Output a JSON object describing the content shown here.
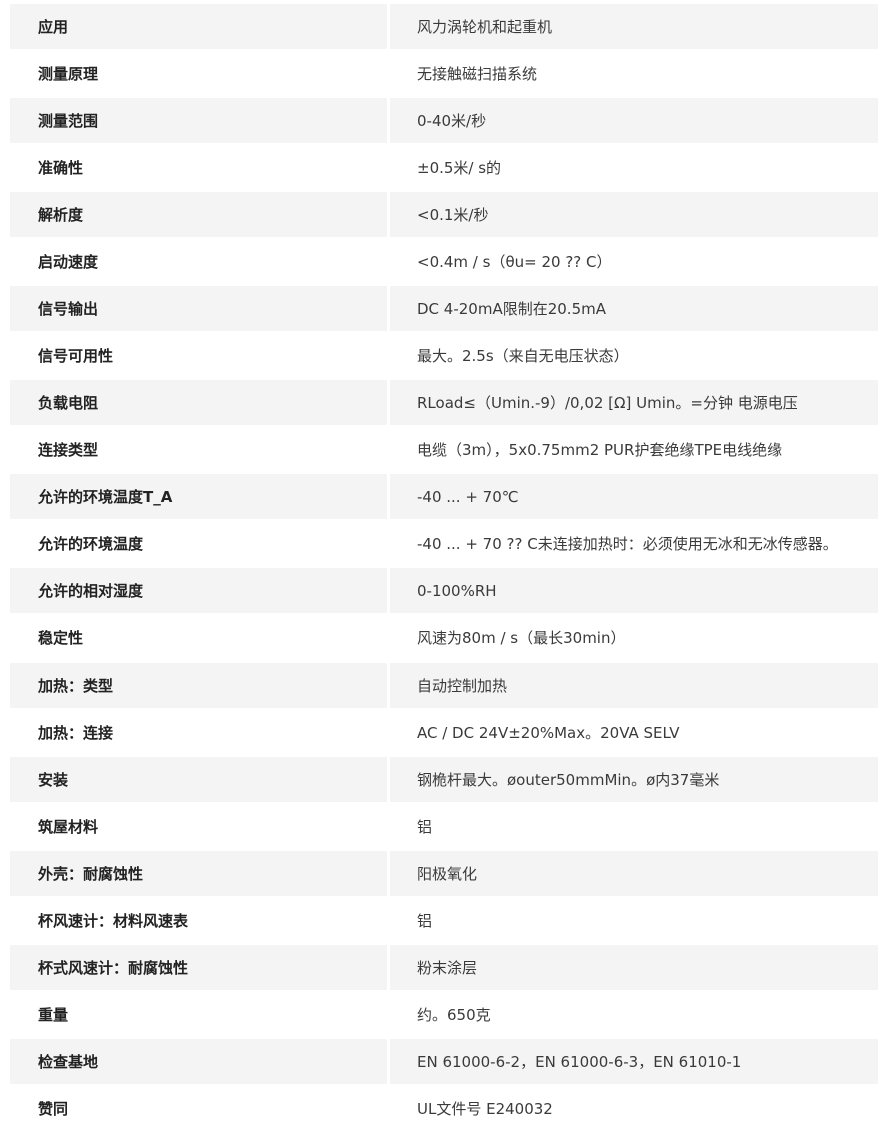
{
  "rows": [
    {
      "label": "应用",
      "value": "风力涡轮机和起重机"
    },
    {
      "label": "测量原理",
      "value": "无接触磁扫描系统"
    },
    {
      "label": "测量范围",
      "value": "0-40米/秒"
    },
    {
      "label": "准确性",
      "value": "±0.5米/ s的"
    },
    {
      "label": "解析度",
      "value": "<0.1米/秒"
    },
    {
      "label": "启动速度",
      "value": "<0.4m / s（θu= 20 ?? C）"
    },
    {
      "label": "信号输出",
      "value": "DC 4-20mA限制在20.5mA"
    },
    {
      "label": "信号可用性",
      "value": "最大。2.5s（来自无电压状态）"
    },
    {
      "label": "负载电阻",
      "value": "RLoad≤（Umin.-9）/0,02 [Ω] Umin。=分钟 电源电压"
    },
    {
      "label": "连接类型",
      "value": "电缆（3m），5x0.75mm2 PUR护套绝缘TPE电线绝缘"
    },
    {
      "label": "允许的环境温度T_A",
      "value": "-40 ... + 70℃"
    },
    {
      "label": "允许的环境温度",
      "value": "-40 ... + 70 ?? C未连接加热时：必须使用无冰和无冰传感器。"
    },
    {
      "label": "允许的相对湿度",
      "value": "0-100%RH"
    },
    {
      "label": "稳定性",
      "value": "风速为80m / s（最长30min）"
    },
    {
      "label": "加热：类型",
      "value": "自动控制加热"
    },
    {
      "label": "加热：连接",
      "value": "AC / DC 24V±20%Max。20VA SELV"
    },
    {
      "label": "安装",
      "value": "钢桅杆最大。øouter50mmMin。ø内37毫米"
    },
    {
      "label": "筑屋材料",
      "value": "铝"
    },
    {
      "label": "外壳：耐腐蚀性",
      "value": "阳极氧化"
    },
    {
      "label": "杯风速计：材料风速表",
      "value": "铝"
    },
    {
      "label": "杯式风速计：耐腐蚀性",
      "value": "粉末涂层"
    },
    {
      "label": "重量",
      "value": "约。650克"
    },
    {
      "label": "检查基地",
      "value": "EN 61000-6-2，EN 61000-6-3，EN 61010-1"
    },
    {
      "label": "赞同",
      "value": "UL文件号 E240032"
    }
  ]
}
